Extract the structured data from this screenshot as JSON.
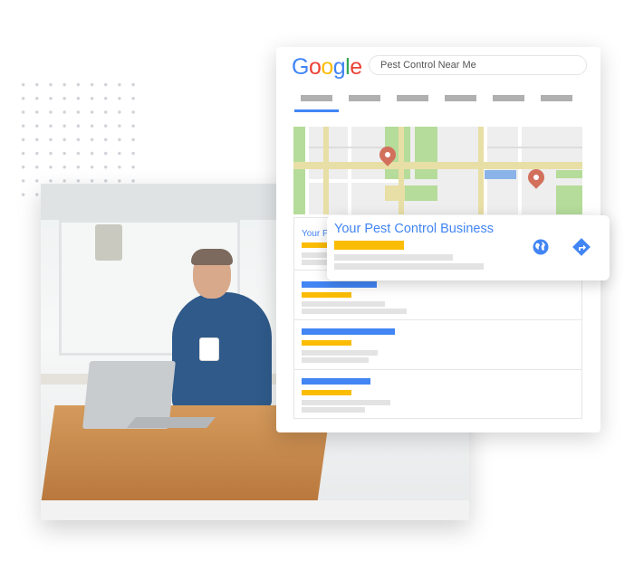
{
  "search": {
    "logo_text": "Google",
    "query": "Pest Control Near Me"
  },
  "logo_colors": [
    "#4285f4",
    "#ea4335",
    "#fbbc04",
    "#4285f4",
    "#34a853",
    "#ea4335"
  ],
  "results": {
    "first_title_truncated": "Your P"
  },
  "business_card": {
    "title": "Your Pest Control Business",
    "icons": [
      "globe-icon",
      "directions-icon"
    ]
  },
  "colors": {
    "accent_blue": "#4285f4",
    "yellow": "#fbbc04",
    "pin": "#d2705c",
    "map_green": "#b5dc9a",
    "road": "#e8dfa6"
  }
}
